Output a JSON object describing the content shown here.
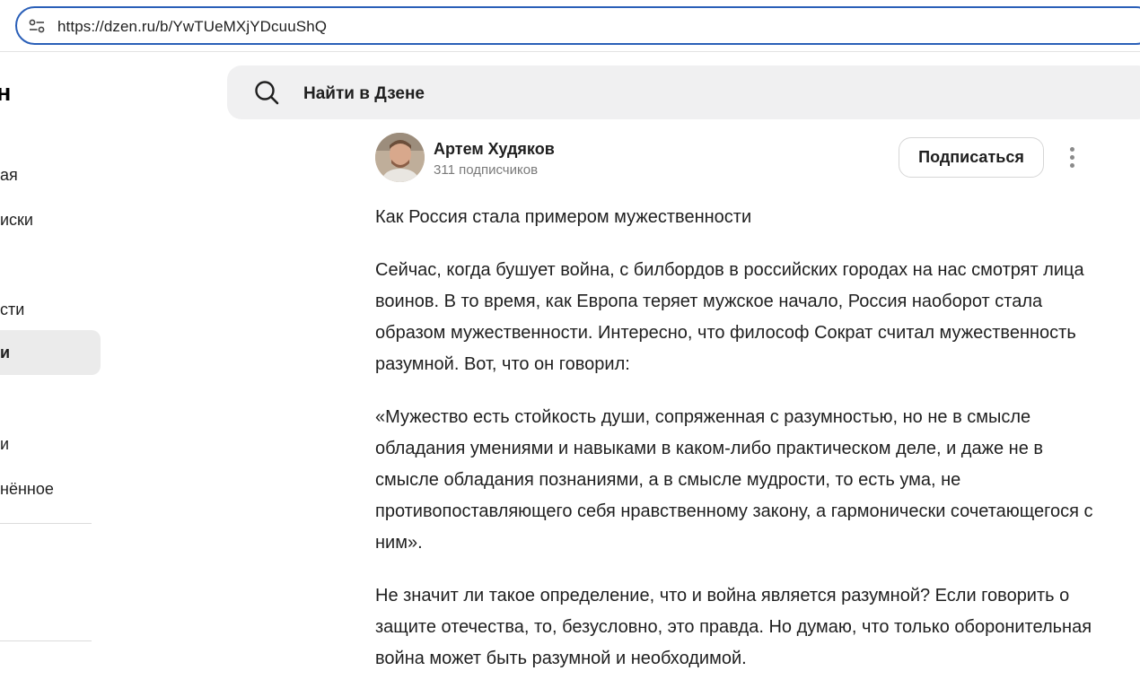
{
  "browser": {
    "url": "https://dzen.ru/b/YwTUeMXjYDcuuShQ"
  },
  "sidebar": {
    "logo_fragment": "н",
    "items": [
      {
        "label": "ая",
        "active": false
      },
      {
        "label": "иски",
        "active": false
      },
      {
        "label": "сти",
        "active": false
      },
      {
        "label": "и",
        "active": true
      },
      {
        "label": "и",
        "active": false
      },
      {
        "label": "нённое",
        "active": false
      }
    ]
  },
  "search": {
    "placeholder": "Найти в Дзене"
  },
  "author": {
    "name": "Артем Худяков",
    "subscribers": "311 подписчиков",
    "subscribe_label": "Подписаться"
  },
  "article": {
    "title": "Как Россия стала примером мужественности",
    "paragraphs": [
      "Сейчас, когда бушует война, с билбордов  в российских городах на нас смотрят лица воинов. В то время, как Европа теряет мужское начало, Россия наоборот стала образом мужественности. Интересно, что философ Сократ считал мужественность разумной. Вот, что он говорил:",
      "«Мужество есть стойкость души, сопряженная с разумностью, но не в смысле обладания умениями и навыками в каком-либо практическом деле, и даже не в смысле обладания познаниями, а в смысле мудрости, то есть ума, не противопоставляющего себя нравственному закону, а гармонически сочетающегося с ним».",
      "Не значит ли такое определение, что и война является разумной? Если говорить о защите отечества, то, безусловно, это правда. Но думаю, что только оборонительная война может быть разумной и необходимой."
    ]
  },
  "colors": {
    "url_border": "#2a5fb8",
    "search_bg": "#f0f0f1",
    "active_nav_bg": "#ebebeb",
    "muted_text": "#7a7a7a"
  }
}
